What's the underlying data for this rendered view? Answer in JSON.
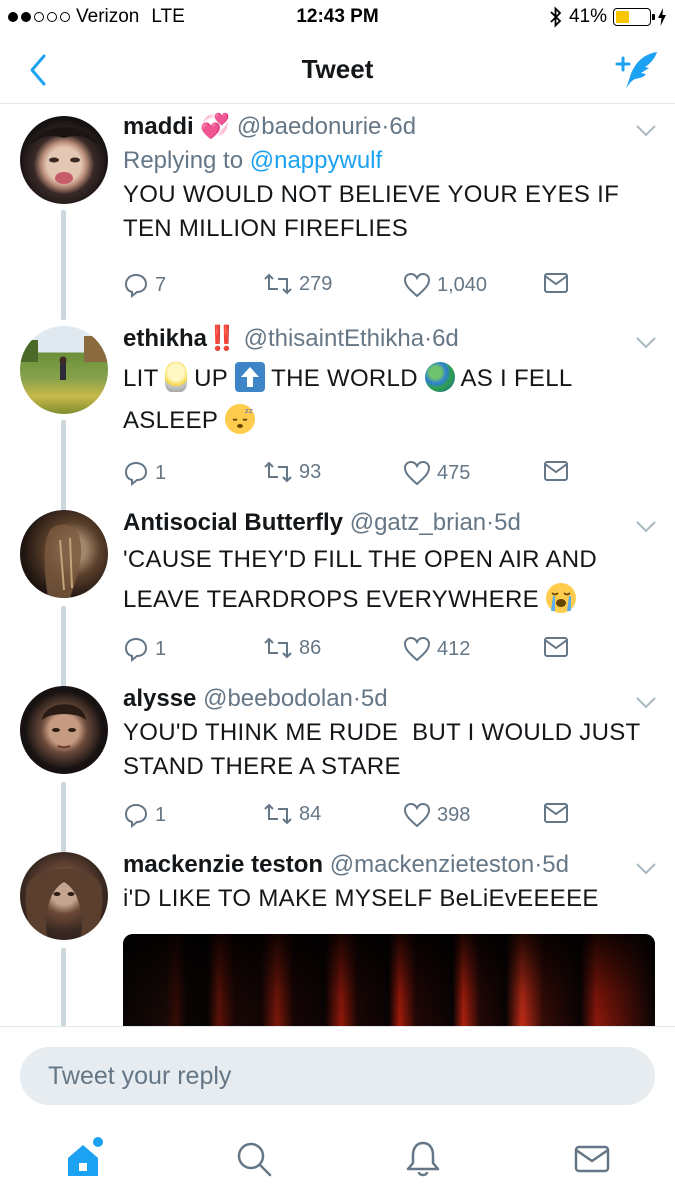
{
  "status_bar": {
    "carrier": "Verizon",
    "network": "LTE",
    "time": "12:43 PM",
    "battery": "41%",
    "battery_level": 0.41,
    "signal_bars_filled": 2,
    "signal_bars_total": 5
  },
  "nav": {
    "title": "Tweet",
    "back_icon": "chevron-left-icon",
    "compose_icon": "compose-tweet-icon"
  },
  "colors": {
    "accent": "#1da1f2",
    "secondary_text": "#657786",
    "thread_line": "#ccd6dd",
    "reply_bg": "#e6ecf0"
  },
  "tweets": [
    {
      "name": "maddi",
      "name_emoji": "💞",
      "handle": "@baedonurie",
      "time": "6d",
      "replying_prefix": "Replying to ",
      "replying_to": "@nappywulf",
      "text": "YOU WOULD NOT BELIEVE YOUR EYES IF TEN MILLION FIREFLIES",
      "replies": "7",
      "retweets": "279",
      "likes": "1,040"
    },
    {
      "name": "ethikha",
      "name_emoji": "‼️",
      "handle": "@thisaintEthikha",
      "time": "6d",
      "text_parts": [
        "LIT ",
        " UP ",
        " THE WORLD ",
        " AS I FELL ASLEEP "
      ],
      "emojis": [
        "light-bulb-emoji",
        "up-arrow-emoji",
        "globe-emoji",
        "sleeping-face-emoji"
      ],
      "replies": "1",
      "retweets": "93",
      "likes": "475"
    },
    {
      "name": "Antisocial Butterfly",
      "handle": "@gatz_brian",
      "time": "5d",
      "text": "'CAUSE THEY'D FILL THE OPEN AIR AND LEAVE TEARDROPS EVERYWHERE ",
      "emoji": "loudly-crying-face-emoji",
      "replies": "1",
      "retweets": "86",
      "likes": "412"
    },
    {
      "name": "alysse",
      "handle": "@beebodolan",
      "time": "5d",
      "text": "YOU'D THINK ME RUDE  BUT I WOULD JUST STAND THERE A STARE",
      "replies": "1",
      "retweets": "84",
      "likes": "398"
    },
    {
      "name": "mackenzie teston",
      "handle": "@mackenzieteston",
      "time": "5d",
      "text": "i'D LIKE TO MAKE MYSELF BeLiEvEEEEE"
    }
  ],
  "separator": "·",
  "reply_bar": {
    "placeholder": "Tweet your reply"
  },
  "tabs": [
    {
      "icon": "home-icon",
      "active": true
    },
    {
      "icon": "search-icon",
      "active": false
    },
    {
      "icon": "notifications-icon",
      "active": false
    },
    {
      "icon": "messages-icon",
      "active": false
    }
  ]
}
